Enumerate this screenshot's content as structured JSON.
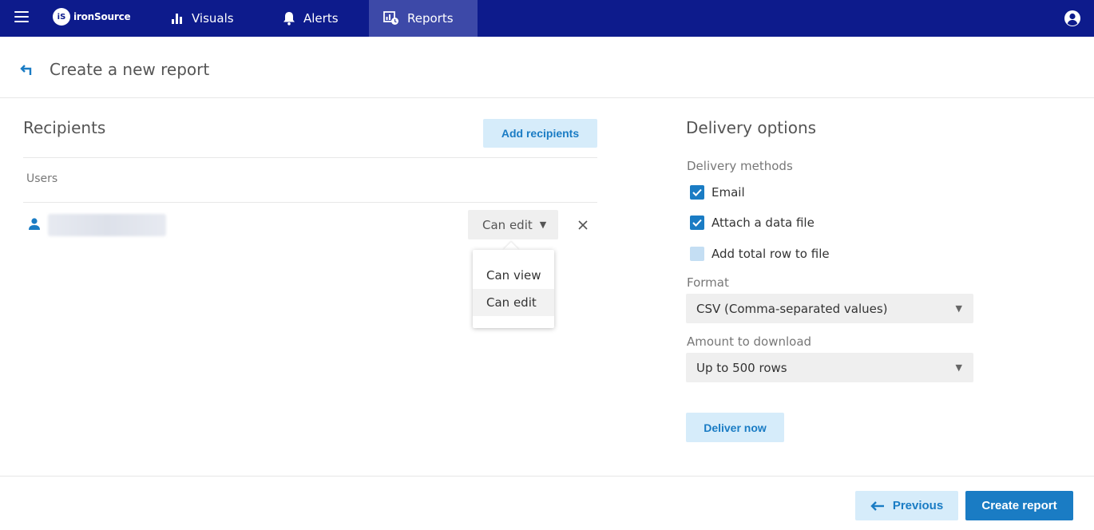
{
  "nav": {
    "logo_mark": "iS",
    "logo_text": "ironSource",
    "items": [
      {
        "label": "Visuals",
        "icon": "bar-chart-icon"
      },
      {
        "label": "Alerts",
        "icon": "bell-icon"
      },
      {
        "label": "Reports",
        "icon": "report-clock-icon",
        "active": true
      }
    ]
  },
  "header": {
    "title": "Create a new report"
  },
  "recipients": {
    "title": "Recipients",
    "add_button": "Add recipients",
    "users_label": "Users",
    "user_permission": "Can edit",
    "permission_options": [
      "Can view",
      "Can edit"
    ],
    "selected_permission": "Can edit"
  },
  "delivery": {
    "title": "Delivery options",
    "methods_label": "Delivery methods",
    "methods": [
      {
        "label": "Email",
        "checked": true
      },
      {
        "label": "Attach a data file",
        "checked": true
      },
      {
        "label": "Add total row to file",
        "checked": false
      }
    ],
    "format_label": "Format",
    "format_value": "CSV (Comma-separated values)",
    "amount_label": "Amount to download",
    "amount_value": "Up to 500 rows",
    "deliver_button": "Deliver now"
  },
  "footer": {
    "previous_button": "Previous",
    "create_button": "Create report"
  },
  "colors": {
    "topbar": "#0d1b8c",
    "active_tab": "#3d49a8",
    "primary": "#1a7cc4",
    "light_button": "#d6ecfa"
  }
}
